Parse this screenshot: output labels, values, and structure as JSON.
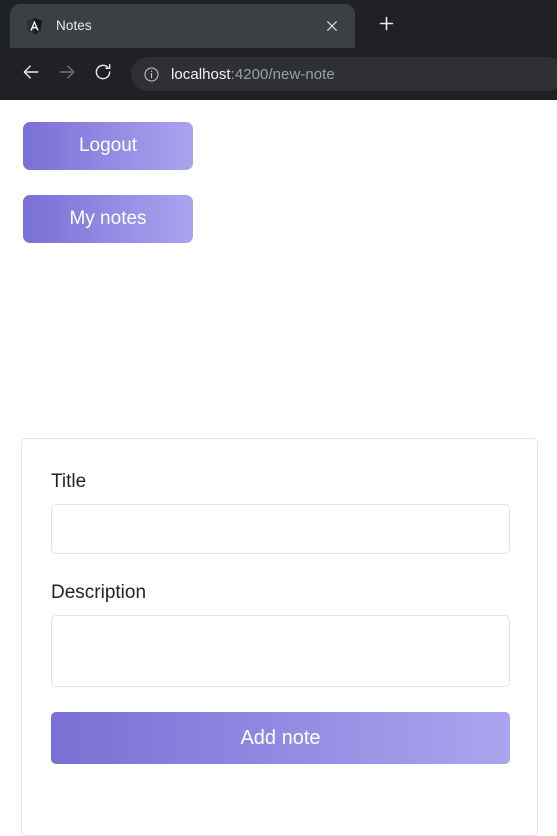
{
  "browser": {
    "tab": {
      "title": "Notes",
      "favicon_icon": "angular-shield-icon",
      "close_icon": "close-icon"
    },
    "new_tab_icon": "plus-icon",
    "nav": {
      "back_icon": "arrow-left-icon",
      "forward_icon": "arrow-right-icon",
      "reload_icon": "reload-icon"
    },
    "omnibox": {
      "info_icon": "info-circle-icon",
      "url_host": "localhost",
      "url_rest": ":4200/new-note",
      "full_url": "localhost:4200/new-note"
    }
  },
  "page": {
    "actions": {
      "logout_label": "Logout",
      "my_notes_label": "My notes"
    },
    "form": {
      "title_label": "Title",
      "title_value": "",
      "title_placeholder": "",
      "description_label": "Description",
      "description_value": "",
      "description_placeholder": "",
      "submit_label": "Add note"
    }
  },
  "colors": {
    "gradient_start": "#7a6fd6",
    "gradient_end": "#aaa4ef",
    "submit_gradient_start": "#7a6fd4",
    "submit_gradient_end": "#aba5f0",
    "chrome_bg": "#202124",
    "tab_active_bg": "#3c4043",
    "omnibox_bg": "#2f3033",
    "card_border": "#e3e4e6",
    "input_border": "#dfe3e8",
    "page_bg": "#ffffff",
    "text_primary": "#1e222a"
  }
}
